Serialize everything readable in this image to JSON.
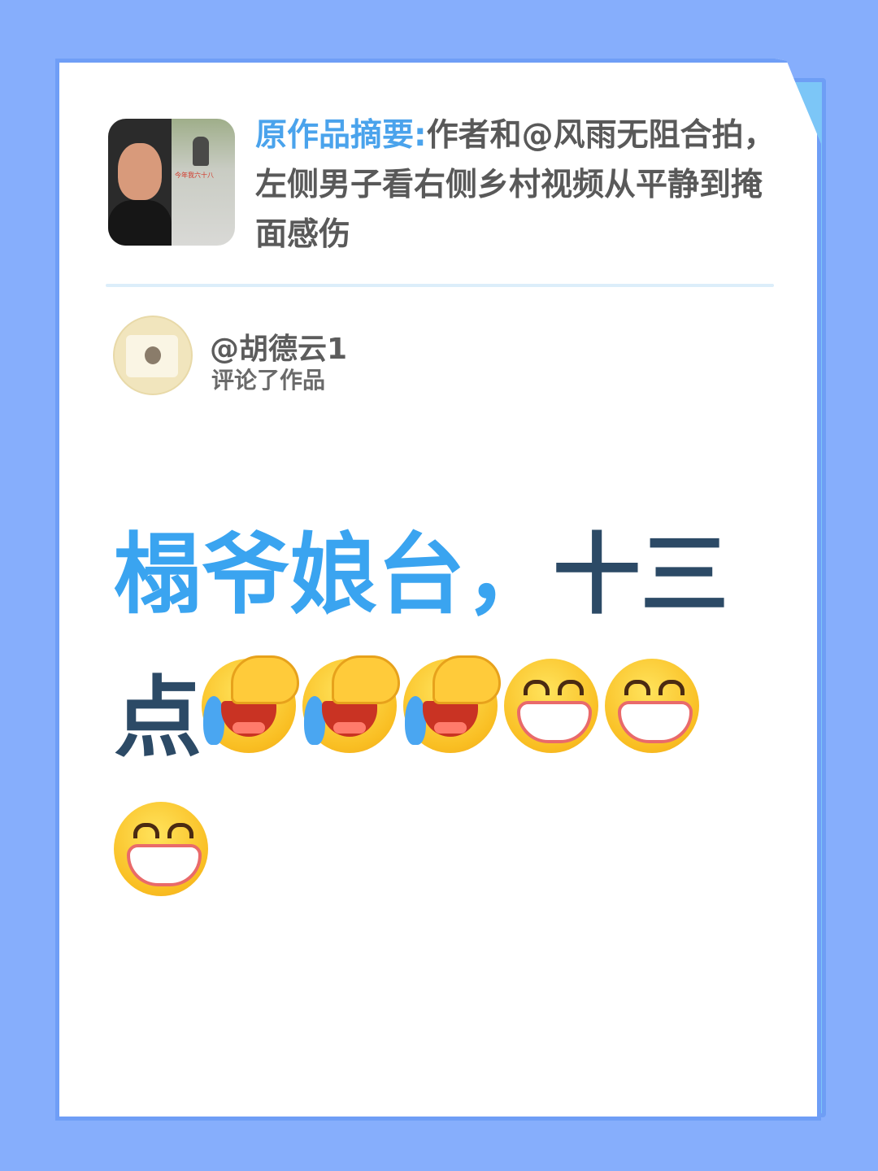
{
  "summary": {
    "label": "原作品摘要:",
    "text": "作者和@风雨无阻合拍，左侧男子看右侧乡村视频从平静到掩面感伤",
    "thumbnail_caption": "今年我六十八"
  },
  "commenter": {
    "name": "@胡德云1",
    "action": "评论了作品"
  },
  "comment": {
    "highlight": "榻爷娘台，",
    "dark": "十三点",
    "emojis": [
      "facepalm-crying-emoji",
      "facepalm-crying-emoji",
      "facepalm-crying-emoji",
      "grinning-emoji",
      "grinning-emoji",
      "grinning-emoji"
    ]
  },
  "colors": {
    "background": "#86aefc",
    "accent": "#3aa4f0",
    "dark_text": "#2c4a66"
  }
}
